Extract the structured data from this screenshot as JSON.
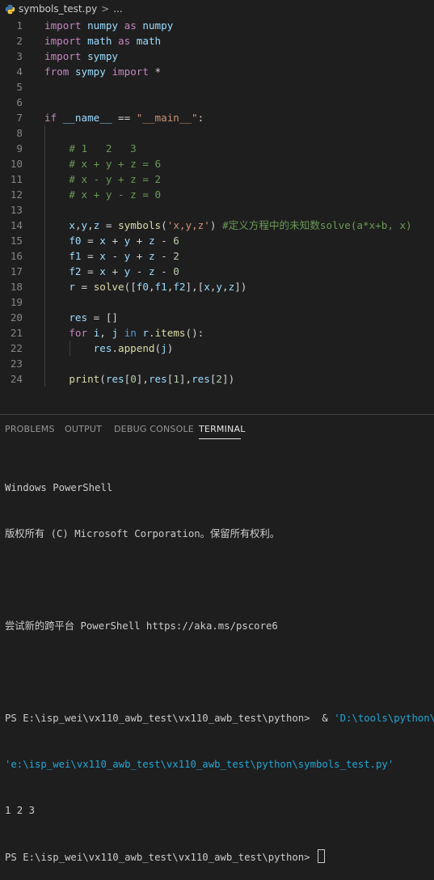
{
  "breadcrumb": {
    "file": "symbols_test.py",
    "separator": ">",
    "more": "..."
  },
  "editor": {
    "lines": [
      {
        "n": "1",
        "tokens": [
          [
            "kw",
            "import"
          ],
          [
            "tx",
            " "
          ],
          [
            "id",
            "numpy"
          ],
          [
            "tx",
            " "
          ],
          [
            "kw",
            "as"
          ],
          [
            "tx",
            " "
          ],
          [
            "id",
            "numpy"
          ]
        ]
      },
      {
        "n": "2",
        "tokens": [
          [
            "kw",
            "import"
          ],
          [
            "tx",
            " "
          ],
          [
            "id",
            "math"
          ],
          [
            "tx",
            " "
          ],
          [
            "kw",
            "as"
          ],
          [
            "tx",
            " "
          ],
          [
            "id",
            "math"
          ]
        ]
      },
      {
        "n": "3",
        "tokens": [
          [
            "kw",
            "import"
          ],
          [
            "tx",
            " "
          ],
          [
            "id",
            "sympy"
          ]
        ]
      },
      {
        "n": "4",
        "tokens": [
          [
            "kw",
            "from"
          ],
          [
            "tx",
            " "
          ],
          [
            "id",
            "sympy"
          ],
          [
            "tx",
            " "
          ],
          [
            "kw",
            "import"
          ],
          [
            "tx",
            " *"
          ]
        ]
      },
      {
        "n": "5",
        "tokens": []
      },
      {
        "n": "6",
        "tokens": []
      },
      {
        "n": "7",
        "tokens": [
          [
            "kw",
            "if"
          ],
          [
            "tx",
            " "
          ],
          [
            "id",
            "__name__"
          ],
          [
            "tx",
            " == "
          ],
          [
            "str",
            "\"__main__\""
          ],
          [
            "tx",
            ":"
          ]
        ]
      },
      {
        "n": "8",
        "tokens": []
      },
      {
        "n": "9",
        "tokens": [
          [
            "tx",
            "    "
          ],
          [
            "cm",
            "# 1   2   3"
          ]
        ]
      },
      {
        "n": "10",
        "tokens": [
          [
            "tx",
            "    "
          ],
          [
            "cm",
            "# x + y + z = 6"
          ]
        ]
      },
      {
        "n": "11",
        "tokens": [
          [
            "tx",
            "    "
          ],
          [
            "cm",
            "# x - y + z = 2"
          ]
        ]
      },
      {
        "n": "12",
        "tokens": [
          [
            "tx",
            "    "
          ],
          [
            "cm",
            "# x + y - z = 0"
          ]
        ]
      },
      {
        "n": "13",
        "tokens": []
      },
      {
        "n": "14",
        "tokens": [
          [
            "tx",
            "    "
          ],
          [
            "id",
            "x"
          ],
          [
            "tx",
            ","
          ],
          [
            "id",
            "y"
          ],
          [
            "tx",
            ","
          ],
          [
            "id",
            "z"
          ],
          [
            "tx",
            " = "
          ],
          [
            "fn",
            "symbols"
          ],
          [
            "tx",
            "("
          ],
          [
            "str",
            "'x,y,z'"
          ],
          [
            "tx",
            ") "
          ],
          [
            "cm",
            "#定义方程中的未知数solve(a*x+b, x)"
          ]
        ]
      },
      {
        "n": "15",
        "tokens": [
          [
            "tx",
            "    "
          ],
          [
            "id",
            "f0"
          ],
          [
            "tx",
            " = "
          ],
          [
            "id",
            "x"
          ],
          [
            "tx",
            " + "
          ],
          [
            "id",
            "y"
          ],
          [
            "tx",
            " + "
          ],
          [
            "id",
            "z"
          ],
          [
            "tx",
            " - "
          ],
          [
            "nm",
            "6"
          ]
        ]
      },
      {
        "n": "16",
        "tokens": [
          [
            "tx",
            "    "
          ],
          [
            "id",
            "f1"
          ],
          [
            "tx",
            " = "
          ],
          [
            "id",
            "x"
          ],
          [
            "tx",
            " - "
          ],
          [
            "id",
            "y"
          ],
          [
            "tx",
            " + "
          ],
          [
            "id",
            "z"
          ],
          [
            "tx",
            " - "
          ],
          [
            "nm",
            "2"
          ]
        ]
      },
      {
        "n": "17",
        "tokens": [
          [
            "tx",
            "    "
          ],
          [
            "id",
            "f2"
          ],
          [
            "tx",
            " = "
          ],
          [
            "id",
            "x"
          ],
          [
            "tx",
            " + "
          ],
          [
            "id",
            "y"
          ],
          [
            "tx",
            " - "
          ],
          [
            "id",
            "z"
          ],
          [
            "tx",
            " - "
          ],
          [
            "nm",
            "0"
          ]
        ]
      },
      {
        "n": "18",
        "tokens": [
          [
            "tx",
            "    "
          ],
          [
            "id",
            "r"
          ],
          [
            "tx",
            " = "
          ],
          [
            "fn",
            "solve"
          ],
          [
            "tx",
            "(["
          ],
          [
            "id",
            "f0"
          ],
          [
            "tx",
            ","
          ],
          [
            "id",
            "f1"
          ],
          [
            "tx",
            ","
          ],
          [
            "id",
            "f2"
          ],
          [
            "tx",
            "],["
          ],
          [
            "id",
            "x"
          ],
          [
            "tx",
            ","
          ],
          [
            "id",
            "y"
          ],
          [
            "tx",
            ","
          ],
          [
            "id",
            "z"
          ],
          [
            "tx",
            "])"
          ]
        ]
      },
      {
        "n": "19",
        "tokens": []
      },
      {
        "n": "20",
        "tokens": [
          [
            "tx",
            "    "
          ],
          [
            "id",
            "res"
          ],
          [
            "tx",
            " = []"
          ]
        ]
      },
      {
        "n": "21",
        "tokens": [
          [
            "tx",
            "    "
          ],
          [
            "kw",
            "for"
          ],
          [
            "tx",
            " "
          ],
          [
            "id",
            "i"
          ],
          [
            "tx",
            ", "
          ],
          [
            "id",
            "j"
          ],
          [
            "tx",
            " "
          ],
          [
            "kb",
            "in"
          ],
          [
            "tx",
            " "
          ],
          [
            "id",
            "r"
          ],
          [
            "tx",
            "."
          ],
          [
            "fn",
            "items"
          ],
          [
            "tx",
            "():"
          ]
        ]
      },
      {
        "n": "22",
        "tokens": [
          [
            "tx",
            "        "
          ],
          [
            "id",
            "res"
          ],
          [
            "tx",
            "."
          ],
          [
            "fn",
            "append"
          ],
          [
            "tx",
            "("
          ],
          [
            "id",
            "j"
          ],
          [
            "tx",
            ")"
          ]
        ]
      },
      {
        "n": "23",
        "tokens": []
      },
      {
        "n": "24",
        "tokens": [
          [
            "tx",
            "    "
          ],
          [
            "fn",
            "print"
          ],
          [
            "tx",
            "("
          ],
          [
            "id",
            "res"
          ],
          [
            "tx",
            "["
          ],
          [
            "nm",
            "0"
          ],
          [
            "tx",
            "],"
          ],
          [
            "id",
            "res"
          ],
          [
            "tx",
            "["
          ],
          [
            "nm",
            "1"
          ],
          [
            "tx",
            "],"
          ],
          [
            "id",
            "res"
          ],
          [
            "tx",
            "["
          ],
          [
            "nm",
            "2"
          ],
          [
            "tx",
            "])"
          ]
        ]
      }
    ]
  },
  "panel": {
    "tabs": [
      "PROBLEMS",
      "OUTPUT",
      "DEBUG CONSOLE",
      "TERMINAL"
    ],
    "active_tab": "TERMINAL"
  },
  "terminal": {
    "line1": "Windows PowerShell",
    "line2": "版权所有 (C) Microsoft Corporation。保留所有权利。",
    "line3": "",
    "line4": "尝试新的跨平台 PowerShell https://aka.ms/pscore6",
    "line5": "",
    "prompt": "PS E:\\isp_wei\\vx110_awb_test\\vx110_awb_test\\python>",
    "cmd_amp": "& ",
    "cmd_exe": "'D:\\tools\\python\\python.exe'",
    "cmd_script": "'e:\\isp_wei\\vx110_awb_test\\vx110_awb_test\\python\\symbols_test.py'",
    "output": "1 2 3",
    "prompt2": "PS E:\\isp_wei\\vx110_awb_test\\vx110_awb_test\\python>"
  },
  "colors": {
    "background": "#1e1e1e",
    "keyword": "#c586c0",
    "identifier": "#9cdcfe",
    "function": "#dcdcaa",
    "string": "#ce9178",
    "comment": "#6a9955",
    "number": "#b5cea8",
    "terminal_link": "#23a6d5"
  },
  "icons": {
    "file": "python-file-icon"
  }
}
